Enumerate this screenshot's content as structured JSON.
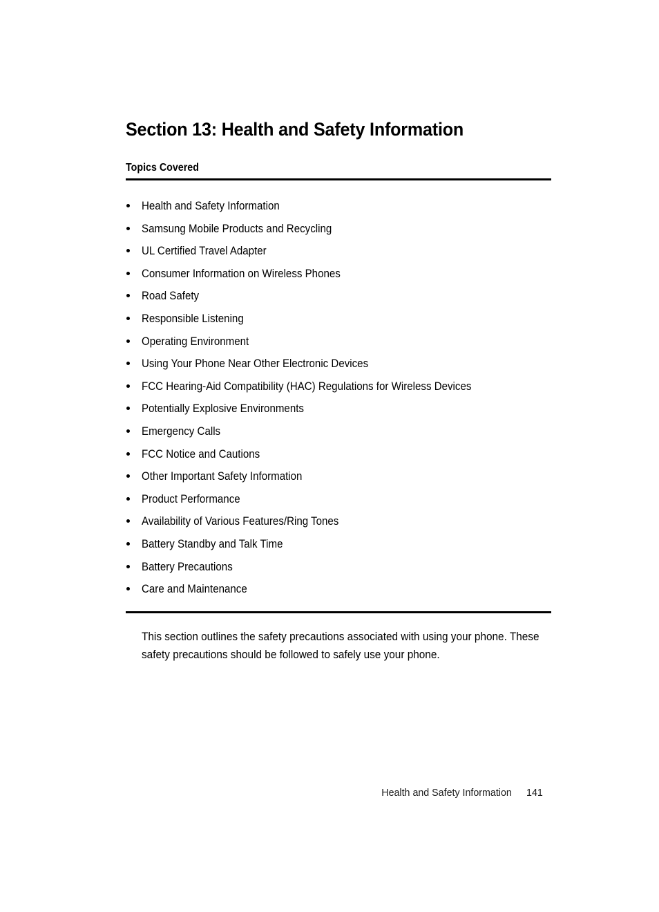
{
  "document": {
    "section_title": "Section 13: Health and Safety Information",
    "topics_heading": "Topics Covered",
    "topics": [
      "Health and Safety Information",
      "Samsung Mobile Products and Recycling",
      "UL Certified Travel Adapter",
      "Consumer Information on Wireless Phones",
      "Road Safety",
      "Responsible Listening",
      "Operating Environment",
      "Using Your Phone Near Other Electronic Devices",
      "FCC Hearing-Aid Compatibility (HAC) Regulations for Wireless Devices",
      "Potentially Explosive Environments",
      "Emergency Calls",
      "FCC Notice and Cautions",
      "Other Important Safety Information",
      "Product Performance",
      "Availability of Various Features/Ring Tones",
      "Battery Standby and Talk Time",
      "Battery Precautions",
      "Care and Maintenance"
    ],
    "intro_paragraph": "This section outlines the safety precautions associated with using your phone. These safety precautions should be followed to safely use your phone.",
    "footer": {
      "running_head": "Health and Safety Information",
      "page_number": "141"
    },
    "colors": {
      "text": "#000000",
      "rule": "#000000",
      "footer_text": "#1a1a1a",
      "background": "#ffffff"
    }
  }
}
